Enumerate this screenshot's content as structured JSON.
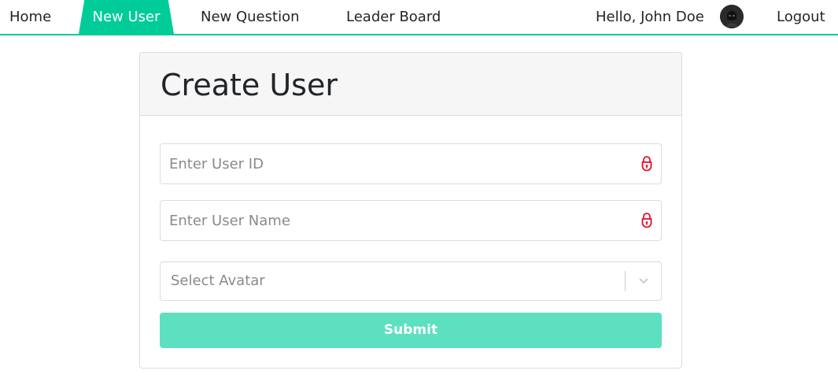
{
  "nav": {
    "home": "Home",
    "new_user": "New User",
    "new_question": "New Question",
    "leader_board": "Leader Board",
    "greeting": "Hello, John Doe",
    "logout": "Logout",
    "avatar_icon": "user-avatar",
    "active_tab": "New User",
    "accent_color": "#00cc99"
  },
  "form": {
    "title": "Create User",
    "user_id": {
      "placeholder": "Enter User ID",
      "value": "",
      "icon": "lock-icon",
      "icon_color": "#e0112b"
    },
    "user_name": {
      "placeholder": "Enter User Name",
      "value": "",
      "icon": "lock-icon",
      "icon_color": "#e0112b"
    },
    "avatar_select": {
      "placeholder": "Select Avatar",
      "icon": "chevron-down-icon"
    },
    "submit_label": "Submit",
    "submit_color": "#5ce0c0"
  }
}
